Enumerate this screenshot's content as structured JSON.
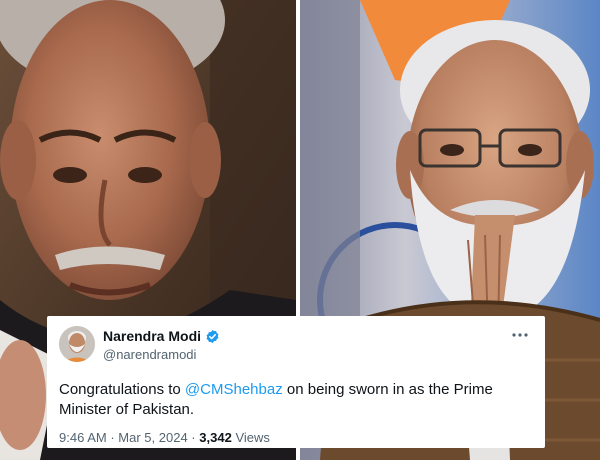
{
  "tweet": {
    "author_name": "Narendra Modi",
    "author_handle": "@narendramodi",
    "more_icon": "more-horizontal-icon",
    "verified_icon": "verified-badge-icon",
    "text_before": "Congratulations to ",
    "mention": "@CMShehbaz",
    "text_after": " on being sworn in as the Prime Minister of Pakistan.",
    "time": "9:46 AM",
    "separator": "·",
    "date": "Mar 5, 2024",
    "views_count": "3,342",
    "views_label": "Views"
  },
  "colors": {
    "mention": "#1d9bf0",
    "verified": "#1d9bf0",
    "text": "#0f1419",
    "muted": "#536471"
  }
}
